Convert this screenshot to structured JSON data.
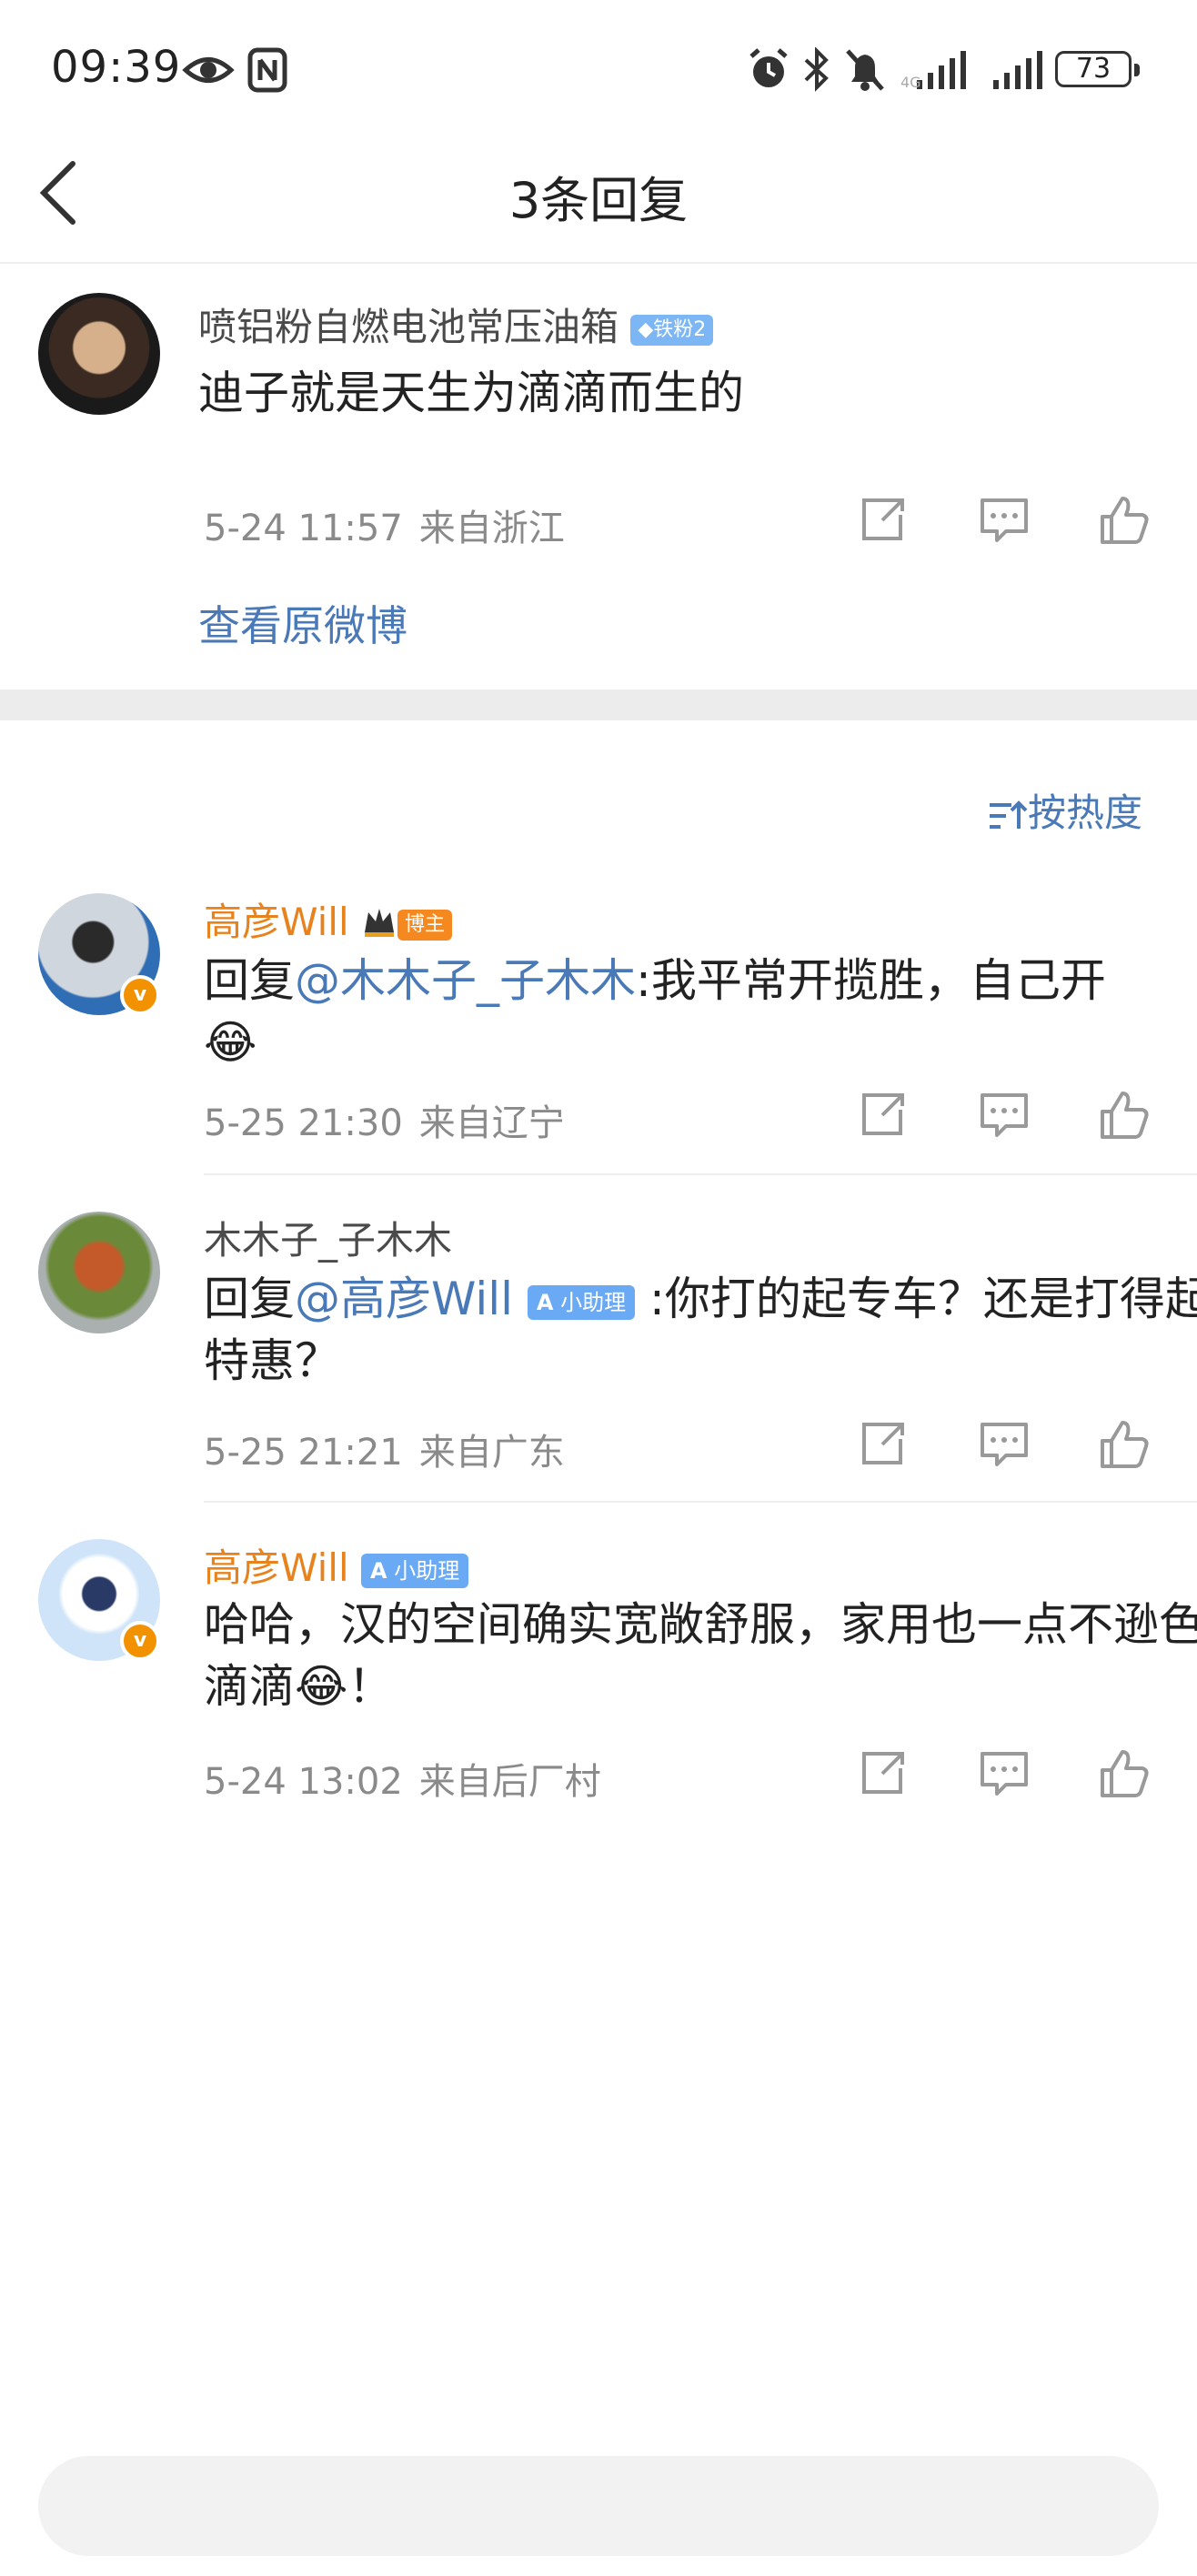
{
  "status_bar": {
    "time": "09:39",
    "battery": "73",
    "icons": [
      "eye-icon",
      "nfc-icon",
      "alarm-icon",
      "bluetooth-icon",
      "mute-icon",
      "signal-icon",
      "signal-icon"
    ]
  },
  "header": {
    "title": "3条回复",
    "back_icon": "chevron-left-icon"
  },
  "original_comment": {
    "username": "喷铝粉自燃电池常压油箱",
    "badge": "◆铁粉2",
    "content": "迪子就是天生为滴滴而生的",
    "date": "5-24 11:57",
    "location": "来自浙江",
    "view_original": "查看原微博"
  },
  "sort": {
    "label": "按热度",
    "icon": "sort-icon"
  },
  "replies": [
    {
      "username": "高彦Will",
      "badge": "博主",
      "prefix": "回复",
      "mention": "@木木子_子木木",
      "text": ":我平常开揽胜，自己开",
      "emoji": "😂",
      "date": "5-25 21:30",
      "location": "来自辽宁"
    },
    {
      "username": "木木子_子木木",
      "prefix": "回复",
      "mention": "@高彦Will",
      "mention_badge": "小助理",
      "text": ":你打的起专车？还是打得起特惠？",
      "date": "5-25 21:21",
      "location": "来自广东"
    },
    {
      "username": "高彦Will",
      "badge": "小助理",
      "text": "哈哈，汉的空间确实宽敞舒服，家用也一点不逊色于滴滴",
      "emoji": "😂",
      "text_end": "！",
      "date": "5-24 13:02",
      "location": "来自后厂村"
    }
  ],
  "colors": {
    "accent_blue": "#4a79b8",
    "username_orange": "#e8821d",
    "meta_gray": "#8a8a8a"
  }
}
